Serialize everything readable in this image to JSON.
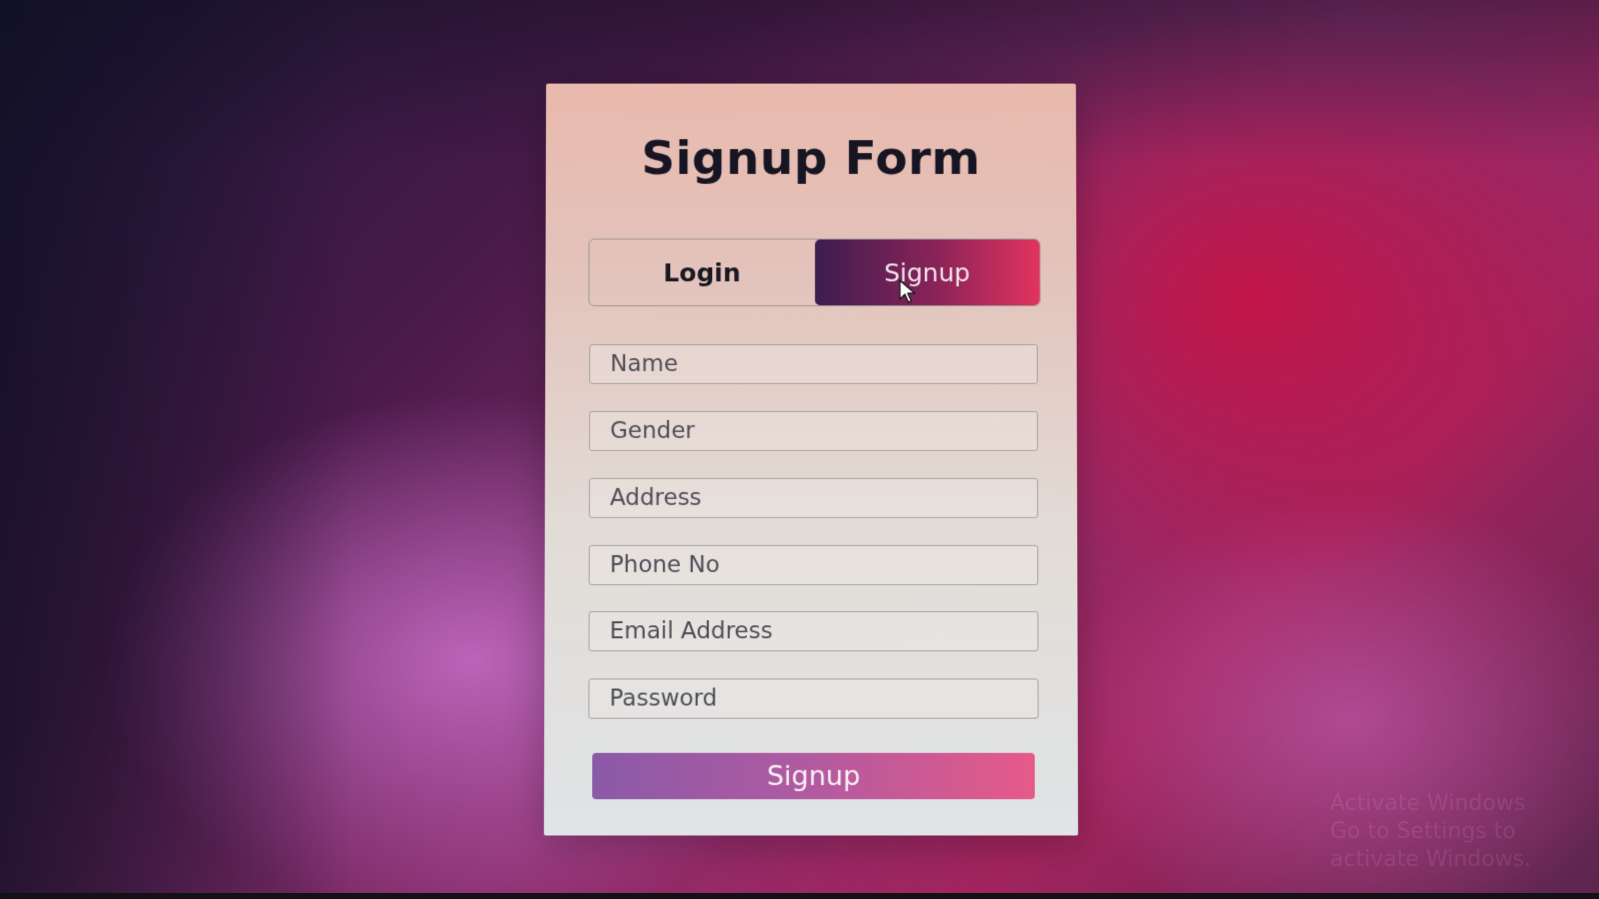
{
  "form": {
    "title": "Signup Form",
    "tabs": [
      {
        "label": "Login",
        "active": false
      },
      {
        "label": "Signup",
        "active": true
      }
    ],
    "fields": [
      {
        "placeholder": "Name",
        "value": ""
      },
      {
        "placeholder": "Gender",
        "value": ""
      },
      {
        "placeholder": "Address",
        "value": ""
      },
      {
        "placeholder": "Phone No",
        "value": ""
      },
      {
        "placeholder": "Email Address",
        "value": ""
      },
      {
        "placeholder": "Password",
        "value": ""
      }
    ],
    "submit_label": "Signup"
  },
  "watermark": {
    "line1": "Activate Windows",
    "line2": "Go to Settings to activate Windows."
  },
  "colors": {
    "active_tab_start": "#3d1d50",
    "active_tab_end": "#e2335e",
    "button_start": "#8a5aa8",
    "button_end": "#e65a88"
  },
  "icons": {
    "cursor": "mouse-pointer-icon"
  }
}
